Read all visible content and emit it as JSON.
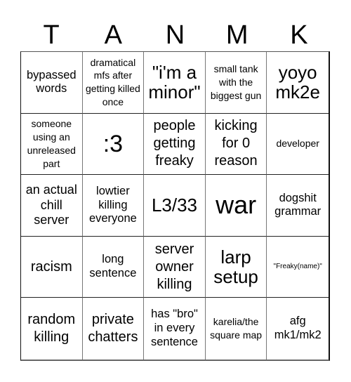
{
  "header": {
    "letters": [
      "T",
      "A",
      "N",
      "M",
      "K"
    ]
  },
  "cells": [
    [
      "bypassed words",
      "dramatical mfs after getting killed once",
      "\"i'm a minor\"",
      "small tank with the biggest gun",
      "yoyo mk2e"
    ],
    [
      "someone using an unreleased part",
      ":3",
      "people getting freaky",
      "kicking for 0 reason",
      "developer"
    ],
    [
      "an actual chill server",
      "lowtier killing everyone",
      "L3/33",
      "war",
      "dogshit grammar"
    ],
    [
      "racism",
      "long sentence",
      "server owner killing",
      "larp setup",
      "\"Freaky(name)\""
    ],
    [
      "random killing",
      "private chatters",
      "has \"bro\" in every sentence",
      "karelia/the square map",
      "afg mk1/mk2"
    ]
  ]
}
